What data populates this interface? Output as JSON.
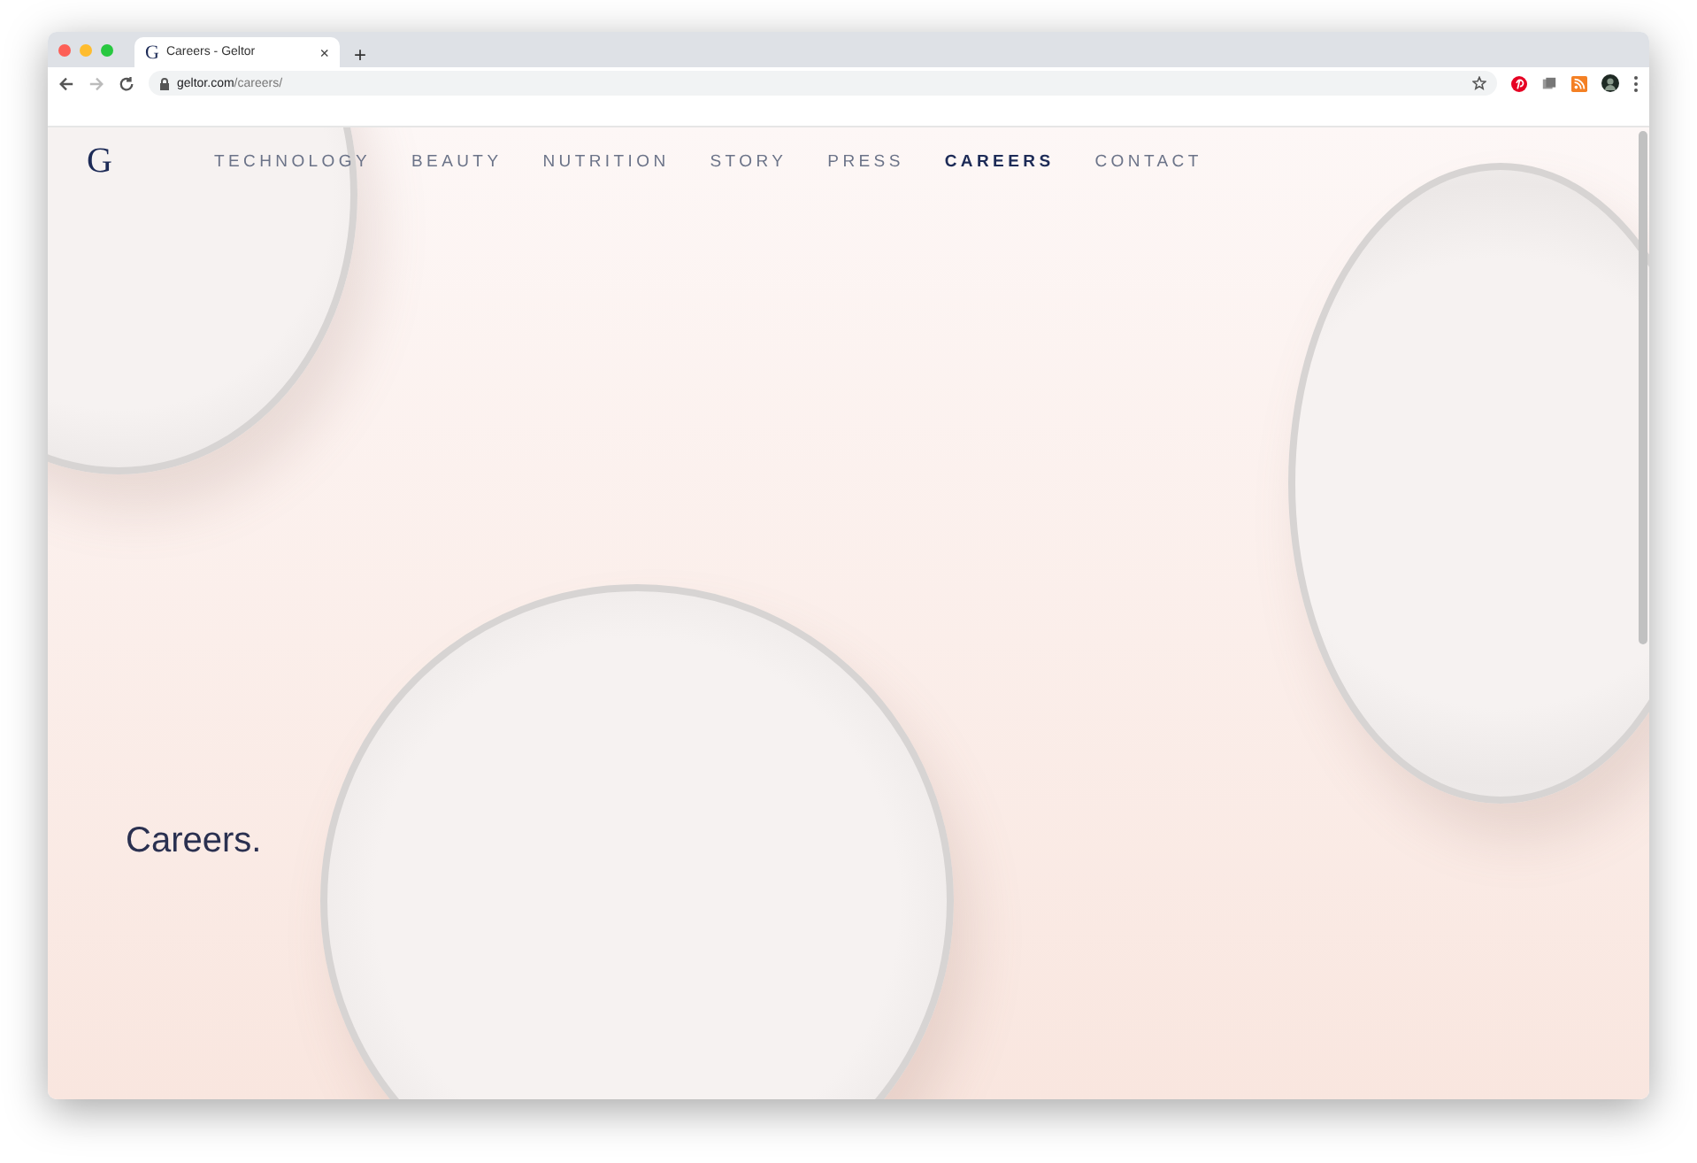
{
  "browser": {
    "tab": {
      "favicon": "G",
      "title": "Careers - Geltor",
      "close": "×"
    },
    "new_tab": "+",
    "url": {
      "domain": "geltor.com",
      "path": "/careers/"
    }
  },
  "site": {
    "logo": "G",
    "nav": [
      {
        "label": "TECHNOLOGY",
        "selected": false
      },
      {
        "label": "BEAUTY",
        "selected": false
      },
      {
        "label": "NUTRITION",
        "selected": false
      },
      {
        "label": "STORY",
        "selected": false
      },
      {
        "label": "PRESS",
        "selected": false
      },
      {
        "label": "CAREERS",
        "selected": true
      },
      {
        "label": "CONTACT",
        "selected": false
      }
    ],
    "heading": "Careers."
  }
}
